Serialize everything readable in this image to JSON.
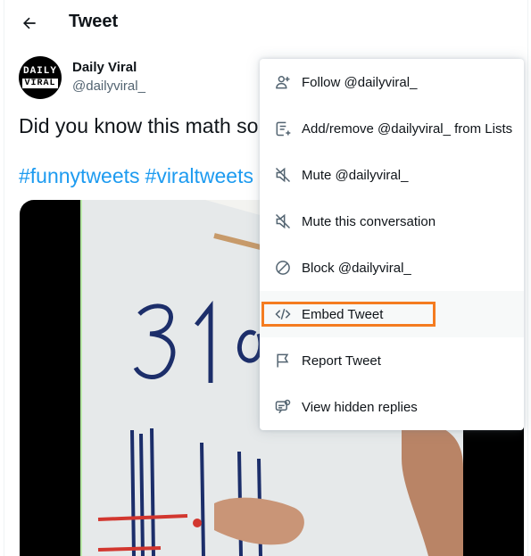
{
  "header": {
    "title": "Tweet",
    "back_icon": "arrow-left-icon"
  },
  "author": {
    "name": "Daily Viral",
    "handle": "@dailyviral_",
    "avatar_line1": "DAILY",
    "avatar_line2": "VIRAL"
  },
  "tweet": {
    "text": "Did you know this math so",
    "hashtags": [
      "#funnytweets",
      "#viraltweets"
    ]
  },
  "menu": {
    "items": [
      {
        "label": "Follow @dailyviral_",
        "icon": "follow-user-icon"
      },
      {
        "label": "Add/remove @dailyviral_ from Lists",
        "icon": "list-add-icon"
      },
      {
        "label": "Mute @dailyviral_",
        "icon": "mute-icon"
      },
      {
        "label": "Mute this conversation",
        "icon": "mute-icon"
      },
      {
        "label": "Block @dailyviral_",
        "icon": "block-icon"
      },
      {
        "label": "Embed Tweet",
        "icon": "code-embed-icon"
      },
      {
        "label": "Report Tweet",
        "icon": "flag-icon"
      },
      {
        "label": "View hidden replies",
        "icon": "hidden-replies-icon"
      }
    ],
    "highlighted_index": 5
  },
  "colors": {
    "accent": "#1d9bf0",
    "highlight_border": "#f47c20",
    "text_primary": "#0f1419",
    "text_secondary": "#536471"
  }
}
